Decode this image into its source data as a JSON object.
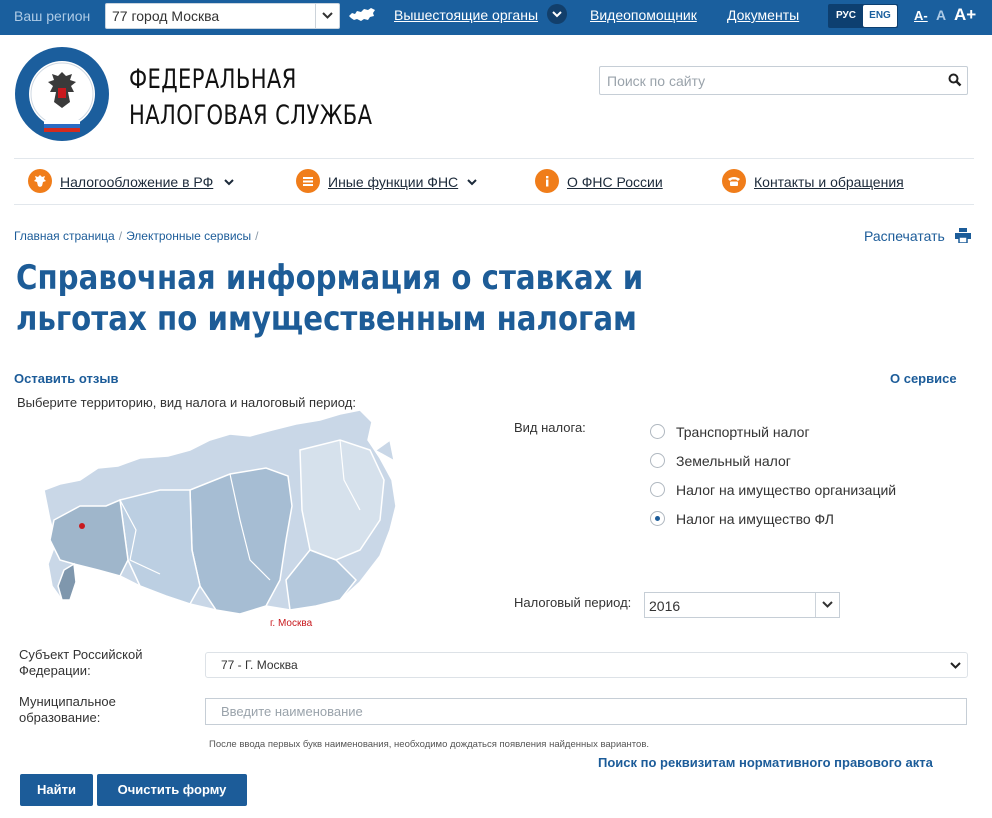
{
  "topbar": {
    "region_label": "Ваш регион",
    "region_value": "77 город Москва",
    "links": {
      "higher_bodies": "Вышестоящие органы",
      "video_help": "Видеопомощник",
      "documents": "Документы"
    },
    "lang": {
      "ru": "РУС",
      "en": "ENG"
    },
    "font_sizes": {
      "small": "A-",
      "medium": "A",
      "large": "A+"
    }
  },
  "header": {
    "brand_line1": "ФЕДЕРАЛЬНАЯ",
    "brand_line2": "НАЛОГОВАЯ СЛУЖБА",
    "search_placeholder": "Поиск по сайту"
  },
  "nav": [
    {
      "label": "Налогообложение в РФ",
      "icon": "emblem-icon"
    },
    {
      "label": "Иные функции ФНС",
      "icon": "menu-icon"
    },
    {
      "label": "О ФНС России",
      "icon": "info-icon"
    },
    {
      "label": "Контакты и обращения",
      "icon": "phone-icon"
    }
  ],
  "breadcrumb": [
    "Главная страница",
    "Электронные сервисы"
  ],
  "print_label": "Распечатать",
  "page": {
    "title": "Справочная информация о ставках и льготах по имущественным налогам",
    "feedback_link": "Оставить отзыв",
    "about_link": "О сервисе",
    "hint": "Выберите территорию, вид налога и налоговый период:",
    "map_caption": "г. Москва"
  },
  "tax": {
    "label": "Вид налога:",
    "options": [
      {
        "label": "Транспортный налог",
        "selected": false
      },
      {
        "label": "Земельный налог",
        "selected": false
      },
      {
        "label": "Налог на имущество организаций",
        "selected": false
      },
      {
        "label": "Налог на имущество ФЛ",
        "selected": true
      }
    ]
  },
  "period": {
    "label": "Налоговый период:",
    "value": "2016"
  },
  "form": {
    "subject_label_1": "Субъект Российской",
    "subject_label_2": "Федерации:",
    "subject_value": "77 - Г. Москва",
    "municipality_label_1": "Муниципальное",
    "municipality_label_2": "образование:",
    "municipality_placeholder": "Введите наименование",
    "note": "После ввода первых букв наименования, необходимо дождаться появления найденных вариантов.",
    "requisites_link": "Поиск по реквизитам нормативного правового акта",
    "find_button": "Найти",
    "clear_button": "Очистить форму"
  },
  "colors": {
    "topbar": "#1a5f9e",
    "accent_blue": "#1c5c99",
    "nav_icon_orange": "#f07d1a",
    "map_caption_red": "#c8191e"
  }
}
